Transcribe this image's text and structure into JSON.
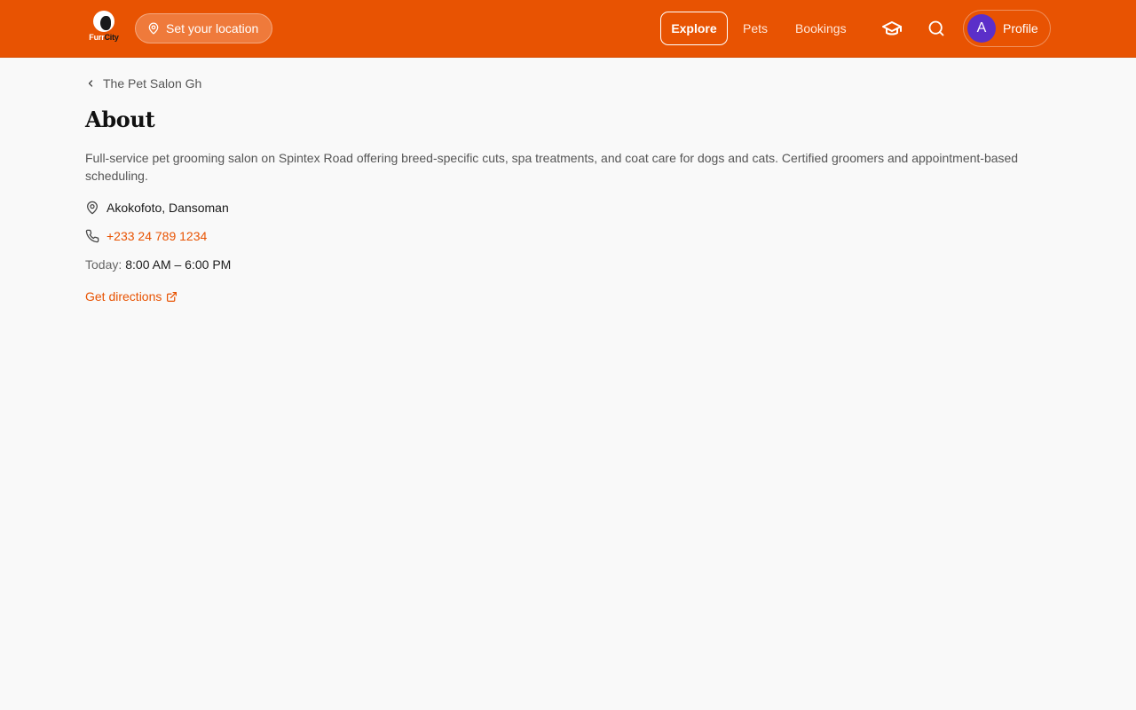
{
  "header": {
    "logo_text_1": "Furr",
    "logo_text_2": "City",
    "location_label": "Set your location",
    "nav": {
      "explore": "Explore",
      "pets": "Pets",
      "bookings": "Bookings"
    },
    "icons": {
      "location": "map-pin-icon",
      "learn": "graduation-cap-icon",
      "search": "search-icon"
    },
    "profile": {
      "avatar_initial": "A",
      "label": "Profile"
    }
  },
  "breadcrumb": {
    "label": "The Pet Salon Gh",
    "icon": "chevron-left-icon"
  },
  "about": {
    "title": "About",
    "description": "Full-service pet grooming salon on Spintex Road offering breed-specific cuts, spa treatments, and coat care for dogs and cats. Certified groomers and appointment-based scheduling.",
    "address": "Akokofoto, Dansoman",
    "phone": "+233 24 789 1234",
    "hours_label": "Today:",
    "hours_value": "8:00 AM – 6:00 PM",
    "directions_label": "Get directions"
  },
  "colors": {
    "brand": "#e85302",
    "avatar": "#5b2fc9",
    "background": "#f9f9f9"
  }
}
